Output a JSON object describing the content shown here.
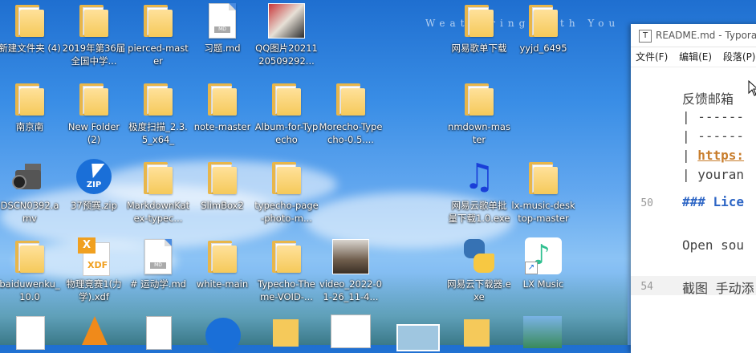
{
  "desktop": {
    "watermark": "Weathering With You",
    "icons": [
      {
        "label": "新建文件夹 (4)",
        "type": "folder"
      },
      {
        "label": "2019年第36届全国中学...",
        "type": "folder"
      },
      {
        "label": "pierced-master",
        "type": "folder"
      },
      {
        "label": "习题.md",
        "type": "doc"
      },
      {
        "label": "QQ图片2021120509292...",
        "type": "image"
      },
      {
        "label": "网易歌单下载",
        "type": "folder"
      },
      {
        "label": "yyjd_6495",
        "type": "folder"
      },
      {
        "label": "南京南",
        "type": "folder"
      },
      {
        "label": "New Folder (2)",
        "type": "folder"
      },
      {
        "label": "极度扫描_2.3.5_x64_",
        "type": "folder"
      },
      {
        "label": "note-master",
        "type": "folder"
      },
      {
        "label": "Album-for-Typecho",
        "type": "folder"
      },
      {
        "label": "Morecho-Typecho-0.5....",
        "type": "folder"
      },
      {
        "label": "nmdown-master",
        "type": "folder"
      },
      {
        "label": "DSCN0392.amv",
        "type": "camera"
      },
      {
        "label": "37预赛.zip",
        "type": "zip"
      },
      {
        "label": "MarkdownKatex-typec...",
        "type": "folder"
      },
      {
        "label": "SlimBox2",
        "type": "folder"
      },
      {
        "label": "typecho-page-photo-m...",
        "type": "folder"
      },
      {
        "label": "网易云歌单批量下载1.0.exe",
        "type": "note"
      },
      {
        "label": "lx-music-desktop-master",
        "type": "folder"
      },
      {
        "label": "baiduwenku_10.0",
        "type": "folder"
      },
      {
        "label": "物理竞赛1(力学).xdf",
        "type": "xdf"
      },
      {
        "label": "# 运动学.md",
        "type": "doc"
      },
      {
        "label": "white-main",
        "type": "folder"
      },
      {
        "label": "Typecho-Theme-VOID-...",
        "type": "folder"
      },
      {
        "label": "video_2022-01-26_11-4...",
        "type": "video"
      },
      {
        "label": "网易云下载器.exe",
        "type": "python"
      },
      {
        "label": "LX Music",
        "type": "lx"
      }
    ]
  },
  "typora": {
    "title": "README.md - Typora",
    "menu": [
      "文件(F)",
      "编辑(E)",
      "段落(P)"
    ],
    "lines": {
      "l1": "反馈邮箱",
      "l2": "| ------",
      "l3": "| ------",
      "l4_link": "https:",
      "l5": "| youran",
      "num50": "50",
      "l50": "### Lice",
      "l52": "Open sou",
      "num54": "54",
      "l54": "截图 手动添"
    }
  }
}
